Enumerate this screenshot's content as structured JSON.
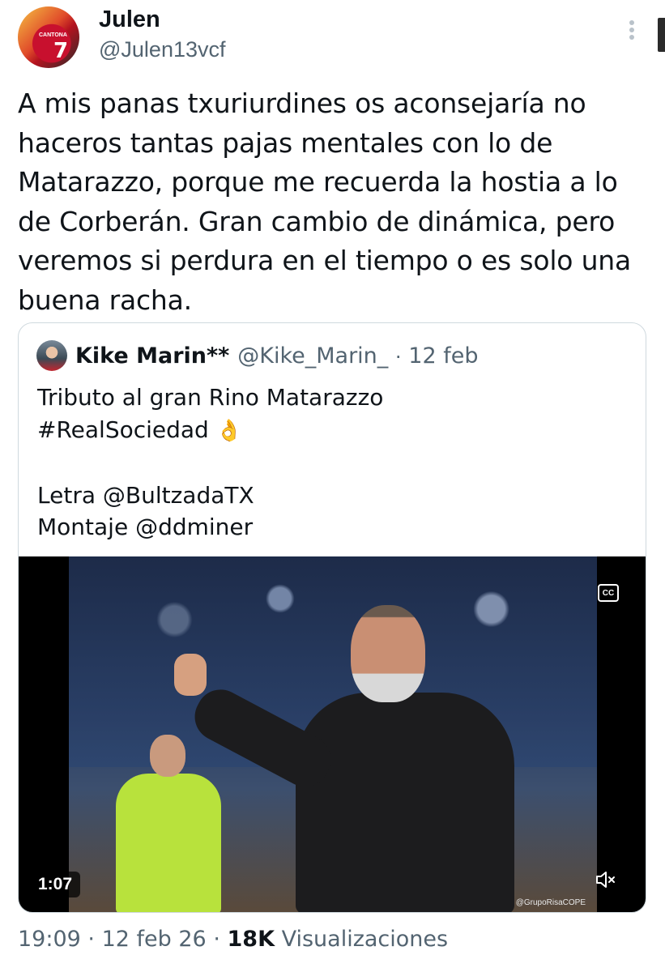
{
  "author": {
    "name": "Julen",
    "handle": "@Julen13vcf",
    "avatar_shirt_text": "CANTONA",
    "avatar_shirt_number": "7"
  },
  "tweet": {
    "lines": [
      "A mis panas txuriurdines os aconsejaría no",
      "haceros tantas pajas mentales con lo de",
      "Matarazzo, porque me recuerda la hostia a lo",
      "de Corberán. Gran cambio de dinámica, pero",
      "veremos si perdura en el tiempo o es solo una",
      "buena racha."
    ]
  },
  "quote": {
    "name": "Kike Marin**",
    "handle": "@Kike_Marin_",
    "separator": "·",
    "date": "12 feb",
    "lines": [
      "Tributo al gran Rino Matarazzo",
      "#RealSociedad",
      "",
      "Letra @BultzadaTX",
      "Montaje @ddminer"
    ],
    "emoji": "👌",
    "video": {
      "duration": "1:07",
      "cc_label": "CC",
      "watermark": "@GrupoRisaCOPE",
      "mute_icon": "speaker-muted-icon"
    }
  },
  "meta": {
    "time": "19:09",
    "separator": "·",
    "date": "12 feb 26",
    "views_count": "18K",
    "views_label": "Visualizaciones"
  },
  "colors": {
    "text_primary": "#0f1419",
    "text_secondary": "#536471",
    "border": "#cfd9de"
  }
}
